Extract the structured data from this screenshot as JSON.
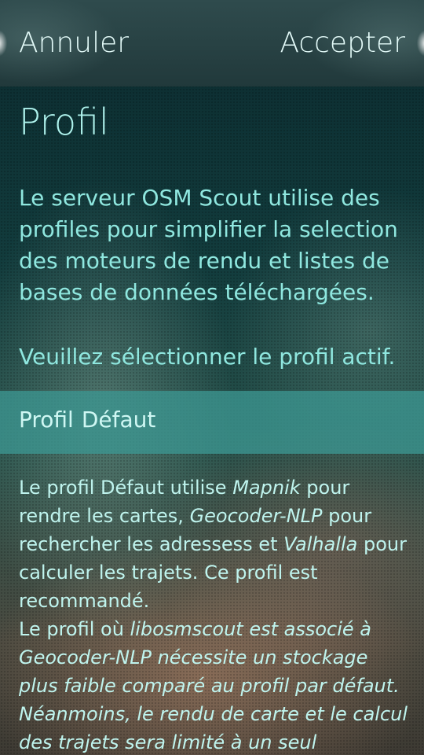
{
  "header": {
    "cancel_label": "Annuler",
    "accept_label": "Accepter"
  },
  "page": {
    "title": "Profil",
    "intro": "Le serveur OSM Scout utilise des profiles pour simplifier la selection des moteurs de rendu et listes de bases de données téléchargées.",
    "select_prompt": "Veuillez sélectionner le profil actif."
  },
  "profile_combo": {
    "label": "Profil",
    "value": "Défaut"
  },
  "description": {
    "p1": {
      "t1": "Le profil Défaut utilise ",
      "renderer": "Mapnik",
      "t2": " pour rendre les cartes, ",
      "geocoder": "Geocoder-NLP",
      "t3": " pour rechercher les adressess et ",
      "router": "Valhalla",
      "t4": " pour calculer les trajets. Ce profil est recommandé."
    },
    "p2": {
      "t1": "Le profil où ",
      "italic": "libosmscout est associé à Geocoder-NLP nécessite un stockage plus faible comparé au profil par défaut. Néanmoins, le rendu de carte et le calcul des trajets sera limité à un seul territoire."
    }
  },
  "colors": {
    "text_primary": "#8fe7df",
    "highlight": "#3c9691",
    "header_bg": "#2f4b4d"
  }
}
